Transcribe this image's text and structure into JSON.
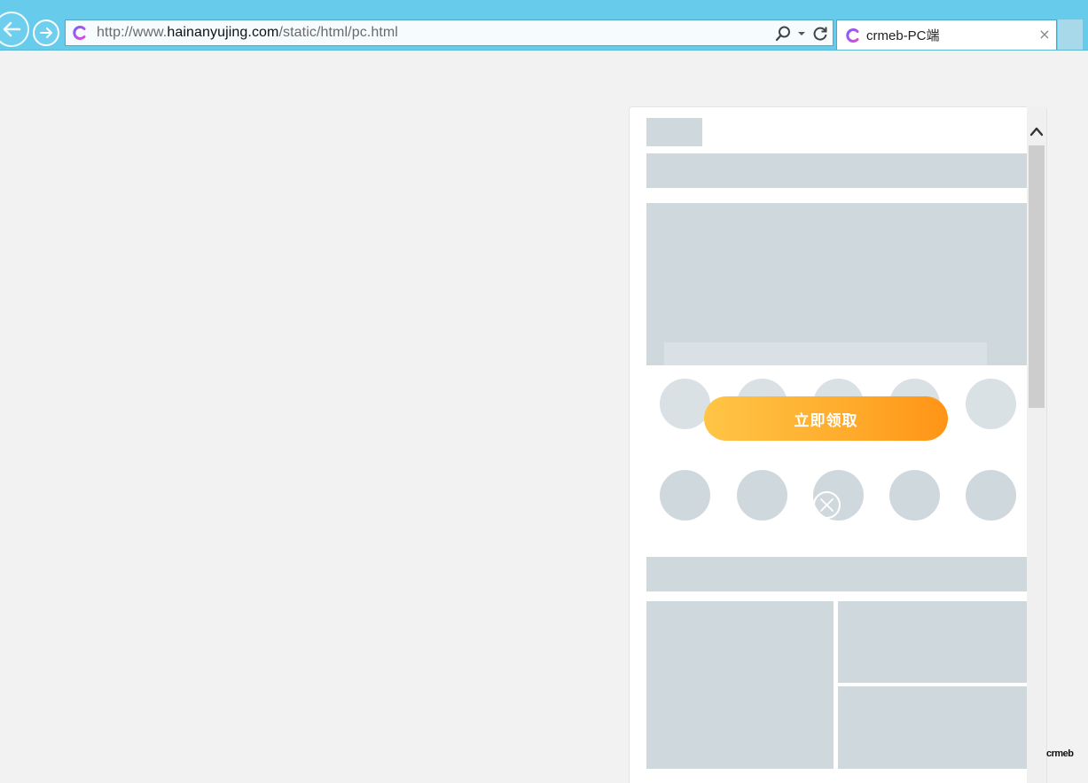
{
  "browser": {
    "url_prefix": "http://www.",
    "url_domain": "hainanyujing.com",
    "url_path": "/static/html/pc.html",
    "tab_title": "crmeb-PC端",
    "tab_close": "×"
  },
  "popup": {
    "cta_label": "立即领取"
  },
  "footer": {
    "brand": "crmeb"
  },
  "colors": {
    "chrome": "#67cceb",
    "skeleton": "#cfd8dc",
    "cta_start": "#ffc546",
    "cta_end": "#ff9416"
  }
}
